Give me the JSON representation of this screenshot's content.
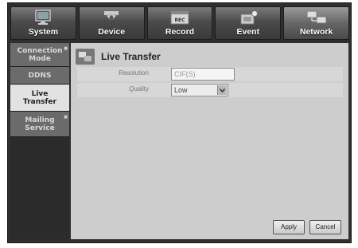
{
  "tabs": [
    {
      "label": "System",
      "icon": "monitor-icon"
    },
    {
      "label": "Device",
      "icon": "camera-icon"
    },
    {
      "label": "Record",
      "icon": "record-icon"
    },
    {
      "label": "Event",
      "icon": "event-icon"
    },
    {
      "label": "Network",
      "icon": "network-icon"
    }
  ],
  "active_tab": "Network",
  "sidebar": {
    "items": [
      {
        "label": "Connection Mode",
        "line1": "Connection",
        "line2": "Mode"
      },
      {
        "label": "DDNS"
      },
      {
        "label": "Live Transfer",
        "line1": "Live",
        "line2": "Transfer"
      },
      {
        "label": "Mailing Service",
        "line1": "Mailing",
        "line2": "Service"
      }
    ],
    "selected": "Live Transfer"
  },
  "page": {
    "title": "Live Transfer",
    "title_icon": "live-transfer-icon"
  },
  "form": {
    "resolution_label": "Resolution",
    "resolution_value": "CIF(S)",
    "quality_label": "Quality",
    "quality_value": "Low"
  },
  "buttons": {
    "apply": "Apply",
    "cancel": "Cancel"
  }
}
